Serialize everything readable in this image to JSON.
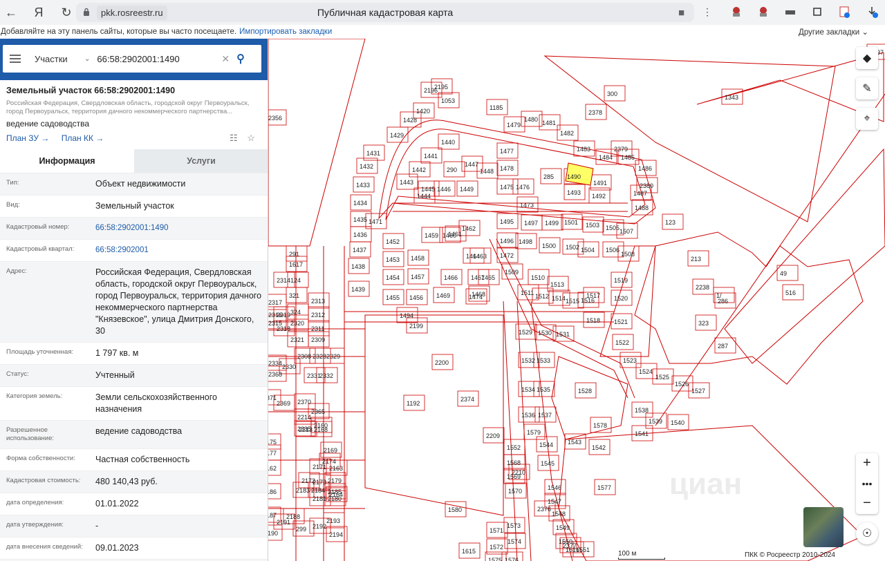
{
  "browser": {
    "url_host": "pkk.rosreestr.ru",
    "page_title": "Публичная кадастровая карта",
    "bookmarks_hint": "Добавляйте на эту панель сайты, которые вы часто посещаете.",
    "import_link": "Импортировать закладки",
    "other_bookmarks": "Другие закладки"
  },
  "search": {
    "type_label": "Участки",
    "query": "66:58:2902001:1490"
  },
  "object": {
    "title": "Земельный участок 66:58:2902001:1490",
    "address_short": "Российская Федерация, Свердловская область, городской округ Первоуральск, город Первоуральск, территория дачного некоммерческого партнерства...",
    "use": "ведение садоводства",
    "plan_zu": "План ЗУ →",
    "plan_kk": "План КК →"
  },
  "tabs": {
    "info": "Информация",
    "services": "Услуги"
  },
  "rows": [
    {
      "k": "Тип:",
      "v": "Объект недвижимости",
      "link": false
    },
    {
      "k": "Вид:",
      "v": "Земельный участок",
      "link": false
    },
    {
      "k": "Кадастровый номер:",
      "v": "66:58:2902001:1490",
      "link": true
    },
    {
      "k": "Кадастровый квартал:",
      "v": "66:58:2902001",
      "link": true
    },
    {
      "k": "Адрес:",
      "v": "Российская Федерация, Свердловская область, городской округ Первоуральск, город Первоуральск, территория дачного некоммерческого партнерства \"Князевское\", улица Дмитрия Донского, 30",
      "link": false
    },
    {
      "k": "Площадь уточненная:",
      "v": "1 797 кв. м",
      "link": false
    },
    {
      "k": "Статус:",
      "v": "Учтенный",
      "link": false
    },
    {
      "k": "Категория земель:",
      "v": "Земли сельскохозяйственного назначения",
      "link": false
    },
    {
      "k": "Разрешенное использование:",
      "v": "ведение садоводства",
      "link": false
    },
    {
      "k": "Форма собственности:",
      "v": "Частная собственность",
      "link": false
    },
    {
      "k": "Кадастровая стоимость:",
      "v": "480 140,43 руб.",
      "link": false
    },
    {
      "k": "дата определения:",
      "v": "01.01.2022",
      "link": false
    },
    {
      "k": "дата утверждения:",
      "v": "-",
      "link": false
    },
    {
      "k": "дата внесения сведений:",
      "v": "09.01.2023",
      "link": false
    },
    {
      "k": "дата применения:",
      "v": "01.01.2023",
      "link": false
    }
  ],
  "map": {
    "scale_label": "100 м",
    "copyright": "ПКК © Росреестр 2010-2024",
    "watermark": "циан",
    "highlight_color": "#ffff66",
    "parcel_color": "#cc0000",
    "labels": [
      "300",
      "1343",
      "2356",
      "1185",
      "1479",
      "1480",
      "1481",
      "1482",
      "1483",
      "1484",
      "1485",
      "1486",
      "1053",
      "1420",
      "1428",
      "1429",
      "1431",
      "1432",
      "1433",
      "1434",
      "1435",
      "1436",
      "1437",
      "1438",
      "1439",
      "1440",
      "1441",
      "1442",
      "1443",
      "1444",
      "1445",
      "1446",
      "290",
      "1447",
      "1448",
      "1449",
      "1475",
      "1476",
      "1477",
      "1478",
      "285",
      "1490",
      "1491",
      "1492",
      "1493",
      "1487",
      "1488",
      "1473",
      "1471",
      "1452",
      "1453",
      "1454",
      "1455",
      "1456",
      "1457",
      "1458",
      "1459",
      "1460",
      "1461",
      "1462",
      "1463",
      "1464",
      "1465",
      "1466",
      "1467",
      "1468",
      "1469",
      "1474",
      "1494",
      "1495",
      "1496",
      "1497",
      "1498",
      "1499",
      "1500",
      "1501",
      "1502",
      "1503",
      "1504",
      "1505",
      "1506",
      "1507",
      "1508",
      "1472",
      "1509",
      "1510",
      "1511",
      "1512",
      "1513",
      "1514",
      "1515",
      "1516",
      "1517",
      "1518",
      "1519",
      "1520",
      "1521",
      "1522",
      "1523",
      "1524",
      "1525",
      "1526",
      "1527",
      "2238",
      "323",
      "286",
      "287",
      "49",
      "516",
      "1192",
      "1528",
      "1529",
      "1530",
      "1531",
      "1532",
      "1533",
      "1534",
      "1535",
      "1536",
      "1537",
      "1538",
      "1539",
      "1540",
      "1541",
      "1542",
      "1543",
      "1544",
      "1545",
      "1546",
      "1547",
      "1548",
      "1549",
      "1550",
      "1551",
      "1552",
      "1568",
      "1569",
      "1570",
      "1571",
      "1572",
      "1573",
      "1574",
      "1575",
      "1576",
      "1577",
      "1578",
      "1579",
      "1580",
      "1615",
      "1616",
      "1617",
      "291",
      "124",
      "321",
      "324",
      "2320",
      "2321",
      "2319",
      "2318",
      "2317",
      "2316",
      "2315",
      "2314",
      "2313",
      "2312",
      "2311",
      "2309",
      "2308",
      "2328",
      "2329",
      "2330",
      "2331",
      "2332",
      "2368",
      "2334",
      "2335",
      "2371",
      "2369",
      "2370",
      "2214",
      "2213",
      "2365",
      "2160",
      "2168",
      "2169",
      "2174",
      "2175",
      "2177",
      "2162",
      "2163",
      "2164",
      "2171",
      "2172",
      "2173",
      "2179",
      "2180",
      "2181",
      "2183",
      "2184",
      "2185",
      "2186",
      "2187",
      "2188",
      "2190",
      "2191",
      "299",
      "2192",
      "2193",
      "2194",
      "2195",
      "2196",
      "2197",
      "2199",
      "2200",
      "2374",
      "2209",
      "2210",
      "2376",
      "2377",
      "2378",
      "2379",
      "2380",
      "123",
      "213",
      "1/"
    ]
  }
}
